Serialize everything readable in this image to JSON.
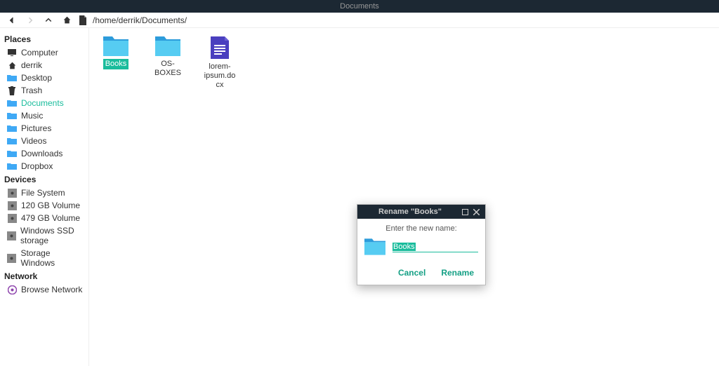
{
  "window": {
    "title": "Documents"
  },
  "toolbar": {
    "path": "/home/derrik/Documents/"
  },
  "sidebar": {
    "sections": [
      {
        "title": "Places",
        "items": [
          {
            "label": "Computer",
            "icon": "computer"
          },
          {
            "label": "derrik",
            "icon": "home"
          },
          {
            "label": "Desktop",
            "icon": "folder"
          },
          {
            "label": "Trash",
            "icon": "trash"
          },
          {
            "label": "Documents",
            "icon": "folder",
            "active": true
          },
          {
            "label": "Music",
            "icon": "folder"
          },
          {
            "label": "Pictures",
            "icon": "folder"
          },
          {
            "label": "Videos",
            "icon": "folder"
          },
          {
            "label": "Downloads",
            "icon": "folder"
          },
          {
            "label": "Dropbox",
            "icon": "folder"
          }
        ]
      },
      {
        "title": "Devices",
        "items": [
          {
            "label": "File System",
            "icon": "disk"
          },
          {
            "label": "120 GB Volume",
            "icon": "disk"
          },
          {
            "label": "479 GB Volume",
            "icon": "disk"
          },
          {
            "label": "Windows SSD storage",
            "icon": "disk"
          },
          {
            "label": "Storage Windows",
            "icon": "disk"
          }
        ]
      },
      {
        "title": "Network",
        "items": [
          {
            "label": "Browse Network",
            "icon": "network"
          }
        ]
      }
    ]
  },
  "files": {
    "items": [
      {
        "label": "Books",
        "type": "folder",
        "selected": true
      },
      {
        "label": "OS-BOXES",
        "type": "folder",
        "selected": false
      },
      {
        "label": "lorem-ipsum.docx",
        "type": "docx",
        "selected": false
      }
    ]
  },
  "dialog": {
    "title": "Rename \"Books\"",
    "prompt": "Enter the new name:",
    "input_value": "Books",
    "cancel_label": "Cancel",
    "confirm_label": "Rename"
  }
}
